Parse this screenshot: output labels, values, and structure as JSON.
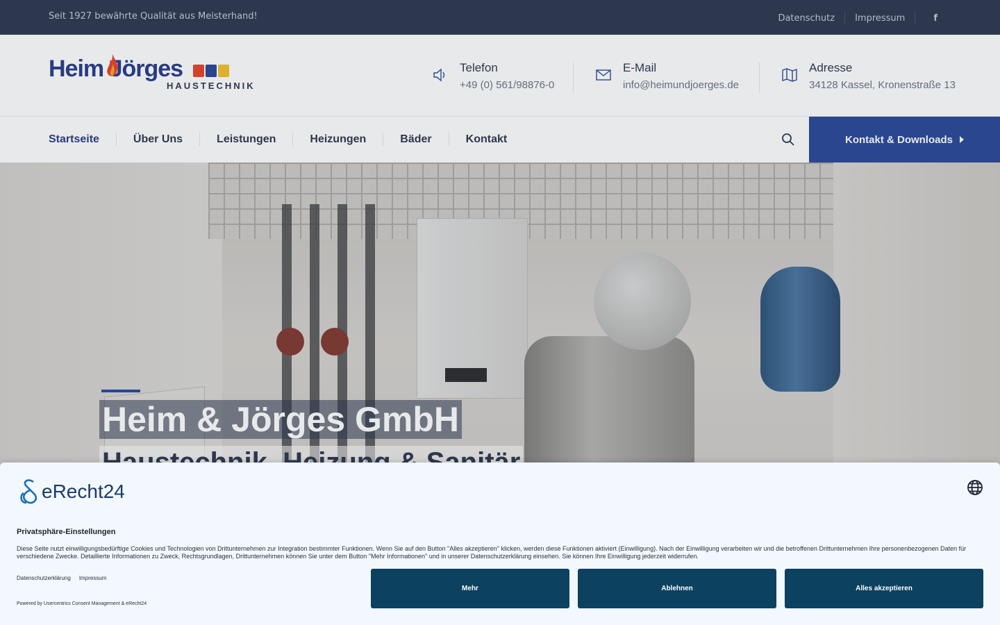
{
  "topbar": {
    "slogan": "Seit 1927 bewährte Qualität aus Meisterhand!",
    "links": [
      "Datenschutz",
      "Impressum"
    ],
    "facebook_icon": "facebook-icon"
  },
  "logo": {
    "name": "Heim Jörges",
    "tagline": "HAUSTECHNIK"
  },
  "contacts": [
    {
      "icon": "speaker-icon",
      "label": "Telefon",
      "value": "+49 (0) 561/98876-0"
    },
    {
      "icon": "envelope-icon",
      "label": "E-Mail",
      "value": "info@heimundjoerges.de"
    },
    {
      "icon": "map-icon",
      "label": "Adresse",
      "value": "34128 Kassel, Kronenstraße 13"
    }
  ],
  "nav": {
    "items": [
      "Startseite",
      "Über Uns",
      "Leistungen",
      "Heizungen",
      "Bäder",
      "Kontakt"
    ],
    "active": "Startseite",
    "cta_label": "Kontakt & Downloads",
    "search_icon": "search-icon"
  },
  "hero": {
    "title": "Heim & Jörges GmbH",
    "subtitle": "Haustechnik, Heizung & Sanitär"
  },
  "consent": {
    "brand": "eRecht24",
    "heading": "Privatsphäre-Einstellungen",
    "description": "Diese Seite nutzt einwilligungsbedürftige Cookies und Technologien von Drittunternehmen zur Integration bestimmter Funktionen. Wenn Sie auf den Button \"Alles akzeptieren\" klicken, werden diese Funktionen aktiviert (Einwilligung). Nach der Einwilligung verarbeiten wir und die betroffenen Drittunternehmen Ihre personenbezogenen Daten für verschiedene Zwecke. Detaillierte Informationen zu Zweck, Rechtsgrundlagen, Drittunternehmen können Sie unter dem Button \"Mehr Informationen\" und in unserer Datenschutzerklärung einsehen. Sie können Ihre Einwilligung jederzeit widerrufen.",
    "links": [
      "Datenschutzerklärung",
      "Impressum"
    ],
    "powered": "Powered by Usercentrics Consent Management & eRecht24",
    "buttons": [
      "Mehr",
      "Ablehnen",
      "Alles akzeptieren"
    ],
    "button_color": "#0c4160"
  },
  "colors": {
    "topbar": "#2f3a52",
    "brand_blue": "#2b4a9a",
    "text_dark": "#2f3a52"
  }
}
